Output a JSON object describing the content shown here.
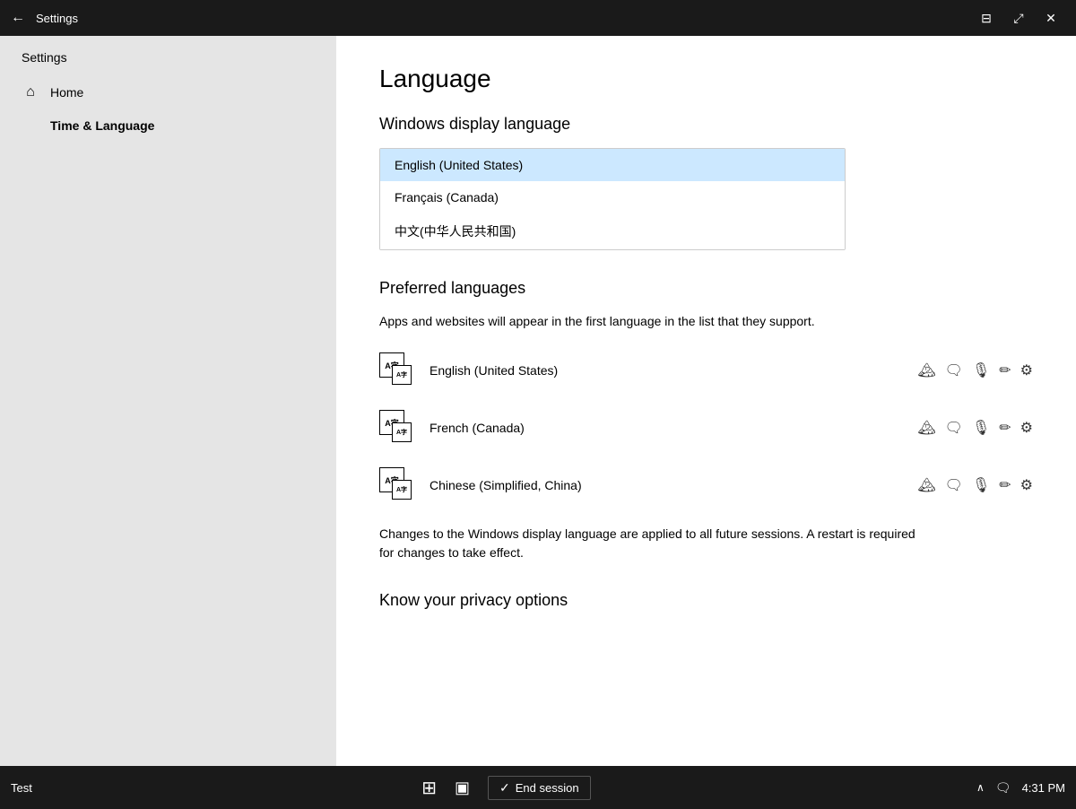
{
  "titlebar": {
    "back_icon": "←",
    "title": "Settings",
    "minimize_icon": "⊟",
    "restore_icon": "⤢",
    "close_icon": "✕"
  },
  "sidebar": {
    "settings_label": "Settings",
    "items": [
      {
        "id": "home",
        "label": "Home",
        "icon": "⌂"
      },
      {
        "id": "time-language",
        "label": "Time & Language",
        "icon": "",
        "active": true
      }
    ]
  },
  "content": {
    "page_title": "Language",
    "windows_display_language": {
      "section_title": "Windows display language",
      "options": [
        {
          "label": "English (United States)",
          "selected": true
        },
        {
          "label": "Français (Canada)",
          "selected": false
        },
        {
          "label": "中文(中华人民共和国)",
          "selected": false
        }
      ]
    },
    "preferred_languages": {
      "section_title": "Preferred languages",
      "description": "Apps and websites will appear in the first language in the list that they support.",
      "languages": [
        {
          "name": "English (United States)"
        },
        {
          "name": "French (Canada)"
        },
        {
          "name": "Chinese (Simplified, China)"
        }
      ],
      "action_icons": [
        "🏔",
        "🗨",
        "🎙",
        "✏",
        "⚙"
      ]
    },
    "notice": "Changes to the Windows display language are applied to all future sessions. A restart is required for changes to take effect.",
    "privacy_section_title": "Know your privacy options"
  },
  "taskbar": {
    "test_label": "Test",
    "windows_icon": "⊞",
    "task_view_icon": "▣",
    "end_session": {
      "circle_icon": "○",
      "label": "End session"
    },
    "chevron_up_icon": "∧",
    "comment_icon": "💬",
    "time": "4:31 PM"
  }
}
